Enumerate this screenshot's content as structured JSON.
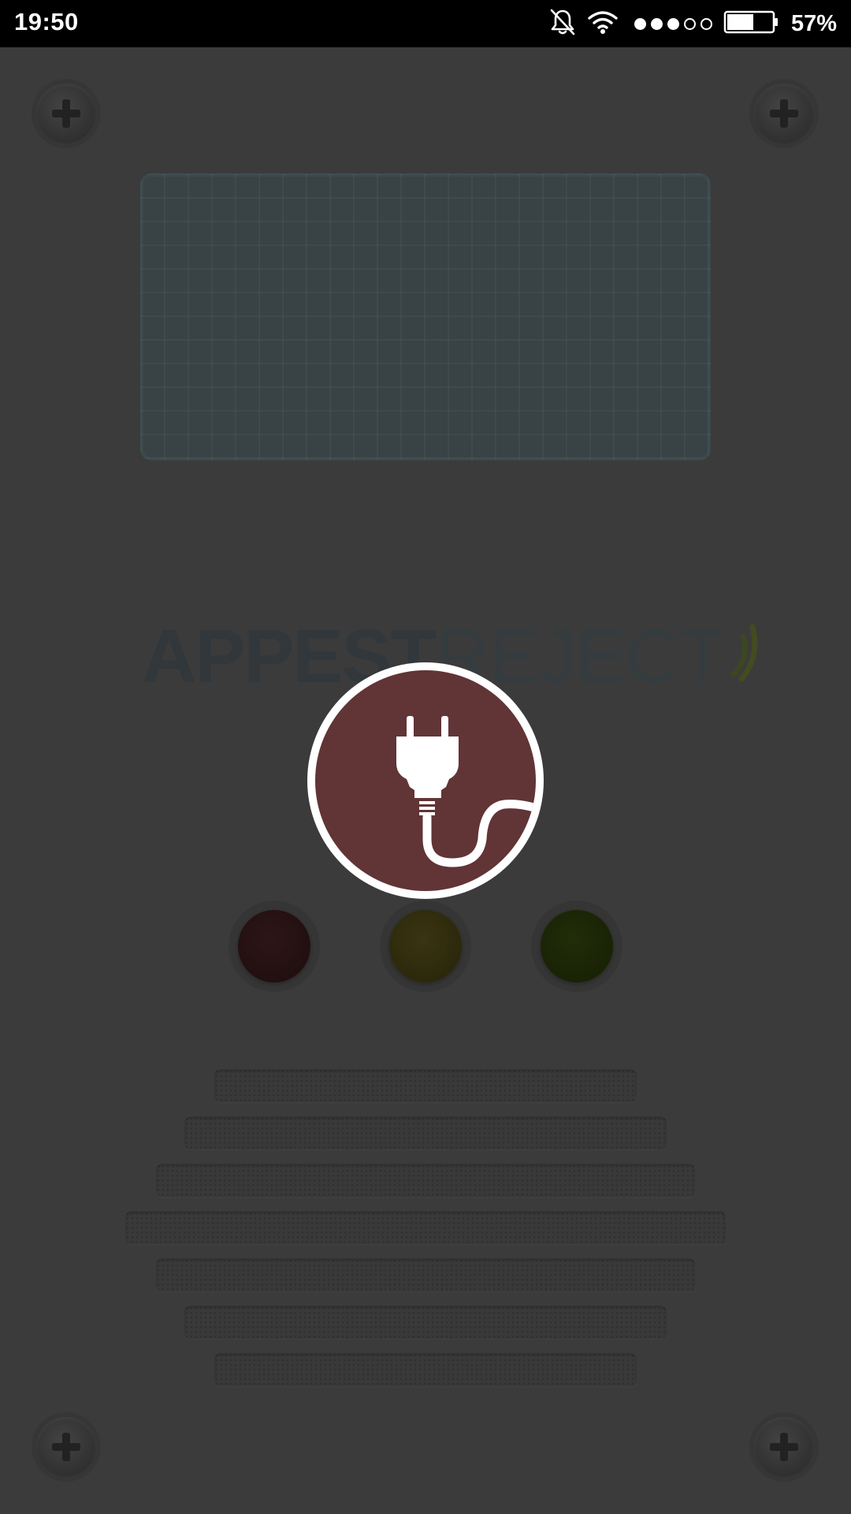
{
  "status_bar": {
    "time": "19:50",
    "battery_percent": "57%",
    "battery_level": 0.57,
    "signal_strength": 3,
    "signal_max": 5,
    "icons": [
      "bell-muted-icon",
      "wifi-icon",
      "signal-icon",
      "battery-icon"
    ]
  },
  "device": {
    "brand_bold": "APPEST",
    "brand_light": "REJECT",
    "led_colors": {
      "red": "#2a1315",
      "yellow": "#36320e",
      "green": "#1f2b06"
    }
  },
  "overlay": {
    "icon": "plug-icon",
    "badge_color": "#613436"
  }
}
